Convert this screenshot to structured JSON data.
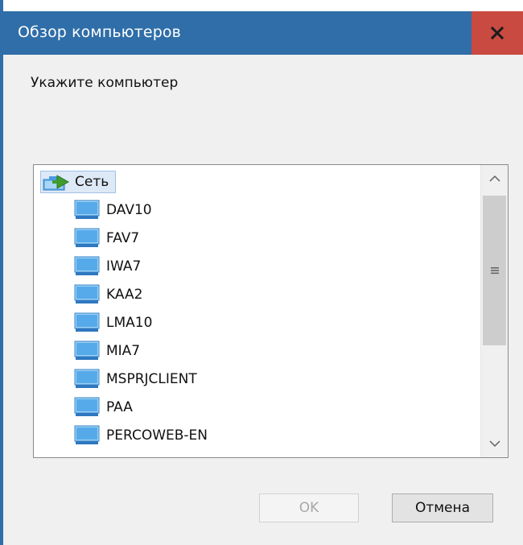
{
  "window": {
    "title": "Обзор компьютеров",
    "close_label": "x",
    "accent": "#2f6ea8",
    "close_color": "#c94a41"
  },
  "prompt": "Укажите компьютер",
  "tree": {
    "root": {
      "label": "Сеть",
      "icon": "network-icon"
    },
    "items": [
      {
        "label": "DAV10",
        "icon": "computer-icon"
      },
      {
        "label": "FAV7",
        "icon": "computer-icon"
      },
      {
        "label": "IWA7",
        "icon": "computer-icon"
      },
      {
        "label": "KAA2",
        "icon": "computer-icon"
      },
      {
        "label": "LMA10",
        "icon": "computer-icon"
      },
      {
        "label": "MIA7",
        "icon": "computer-icon"
      },
      {
        "label": "MSPRJCLIENT",
        "icon": "computer-icon"
      },
      {
        "label": "PAA",
        "icon": "computer-icon"
      },
      {
        "label": "PERCOWEB-EN",
        "icon": "computer-icon"
      }
    ]
  },
  "buttons": {
    "ok": "OK",
    "cancel": "Отмена"
  }
}
